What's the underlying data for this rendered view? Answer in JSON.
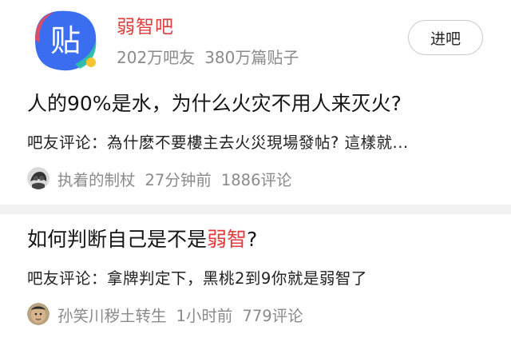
{
  "forum": {
    "logo_text": "贴",
    "name": "弱智吧",
    "members": "202万吧友",
    "posts": "380万篇贴子",
    "enter_label": "进吧"
  },
  "posts": [
    {
      "title_before": "人的90%是水，为什么火灾不用人来灭火?",
      "title_highlight": "",
      "title_after": "",
      "comment": "吧友评论：為什麽不要樓主去火災現場發帖? 這樣就...",
      "author": "执着的制杖",
      "time": "27分钟前",
      "comments_count": "1886评论",
      "avatar_icon": "dark-avatar-icon"
    },
    {
      "title_before": "如何判断自己是不是",
      "title_highlight": "弱智",
      "title_after": "?",
      "comment": "吧友评论：拿牌判定下，黑桃2到9你就是弱智了",
      "author": "孙笑川秽土转生",
      "time": "1小时前",
      "comments_count": "779评论",
      "avatar_icon": "face-avatar-icon"
    }
  ],
  "colors": {
    "accent_red": "#e33b3b",
    "logo_blue": "#3a6df0",
    "meta_gray": "#8a8a8a"
  }
}
